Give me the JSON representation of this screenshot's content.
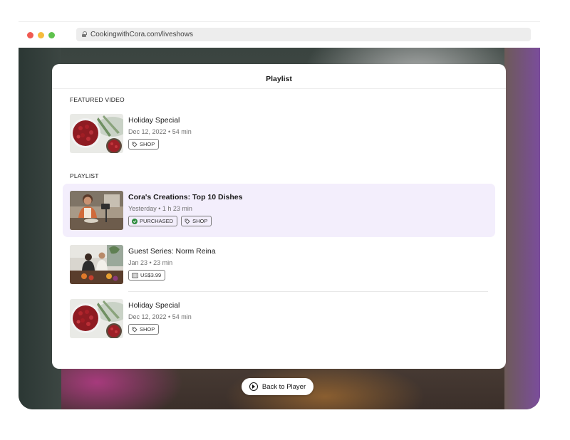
{
  "browser": {
    "url": "CookingwithCora.com/liveshows"
  },
  "modal": {
    "title": "Playlist",
    "featured_label": "FEATURED VIDEO",
    "featured": {
      "title": "Holiday Special",
      "meta": "Dec 12, 2022 • 54 min",
      "tags": [
        "SHOP"
      ]
    },
    "playlist_label": "PLAYLIST",
    "playlist": [
      {
        "title": "Cora's Creations: Top 10 Dishes",
        "meta": "Yesterday • 1 h 23 min",
        "tags": [
          "PURCHASED",
          "SHOP"
        ],
        "selected": true
      },
      {
        "title": "Guest Series: Norm Reina",
        "meta": "Jan 23 • 23 min",
        "tags": [
          "US$3.99"
        ]
      },
      {
        "title": "Holiday Special",
        "meta": "Dec 12, 2022 • 54 min",
        "tags": [
          "SHOP"
        ]
      }
    ]
  },
  "back_button": {
    "label": "Back to Player"
  },
  "colors": {
    "highlight": "#f3eefc",
    "purchased_check": "#2e8b3e"
  }
}
